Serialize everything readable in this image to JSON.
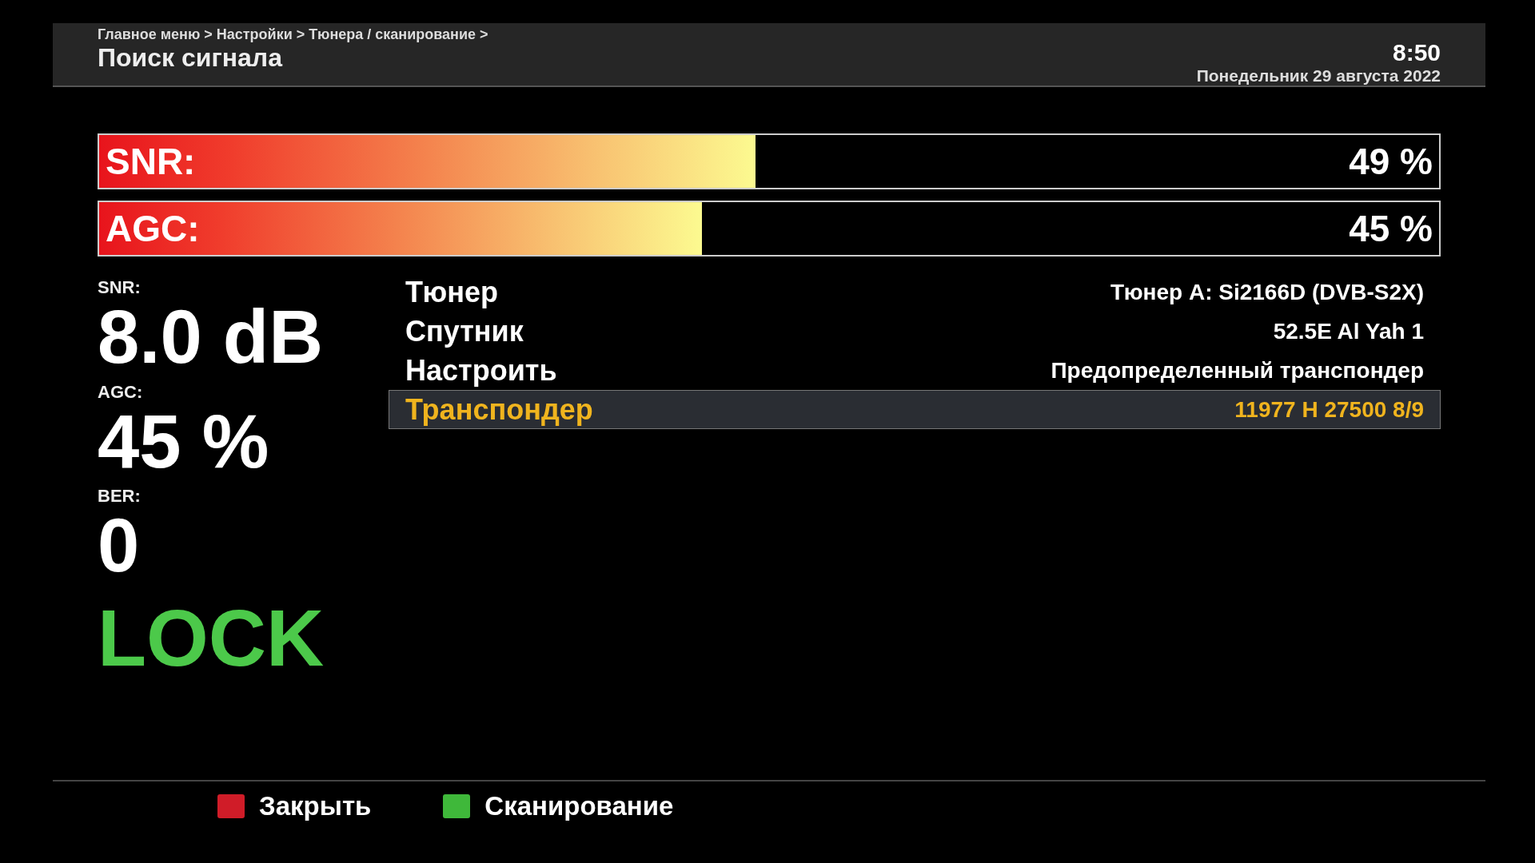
{
  "header": {
    "breadcrumb": "Главное меню > Настройки > Тюнера / сканирование >",
    "title": "Поиск сигнала",
    "time": "8:50",
    "date": "Понедельник 29 августа 2022"
  },
  "meters": [
    {
      "label": "SNR:",
      "level": 0.49,
      "reading": "49 %"
    },
    {
      "label": "AGC:",
      "level": 0.45,
      "reading": "45 %"
    }
  ],
  "readouts": [
    {
      "label": "SNR:",
      "value": "8.0 dB"
    },
    {
      "label": "AGC:",
      "value": "45 %"
    },
    {
      "label": "BER:",
      "value": "0"
    }
  ],
  "lock_status": {
    "text": "LOCK",
    "locked": true
  },
  "settings": [
    {
      "name": "Тюнер",
      "value": "Тюнер A: Si2166D (DVB-S2X)",
      "selected": false
    },
    {
      "name": "Спутник",
      "value": "52.5E Al Yah 1",
      "selected": false
    },
    {
      "name": "Настроить",
      "value": "Предопределенный транспондер",
      "selected": false
    },
    {
      "name": "Транспондер",
      "value": "11977 H 27500 8/9",
      "selected": true
    }
  ],
  "buttons": [
    {
      "label": "Закрыть",
      "color": "#d01c28"
    },
    {
      "label": "Сканирование",
      "color": "#3fb83a"
    }
  ]
}
